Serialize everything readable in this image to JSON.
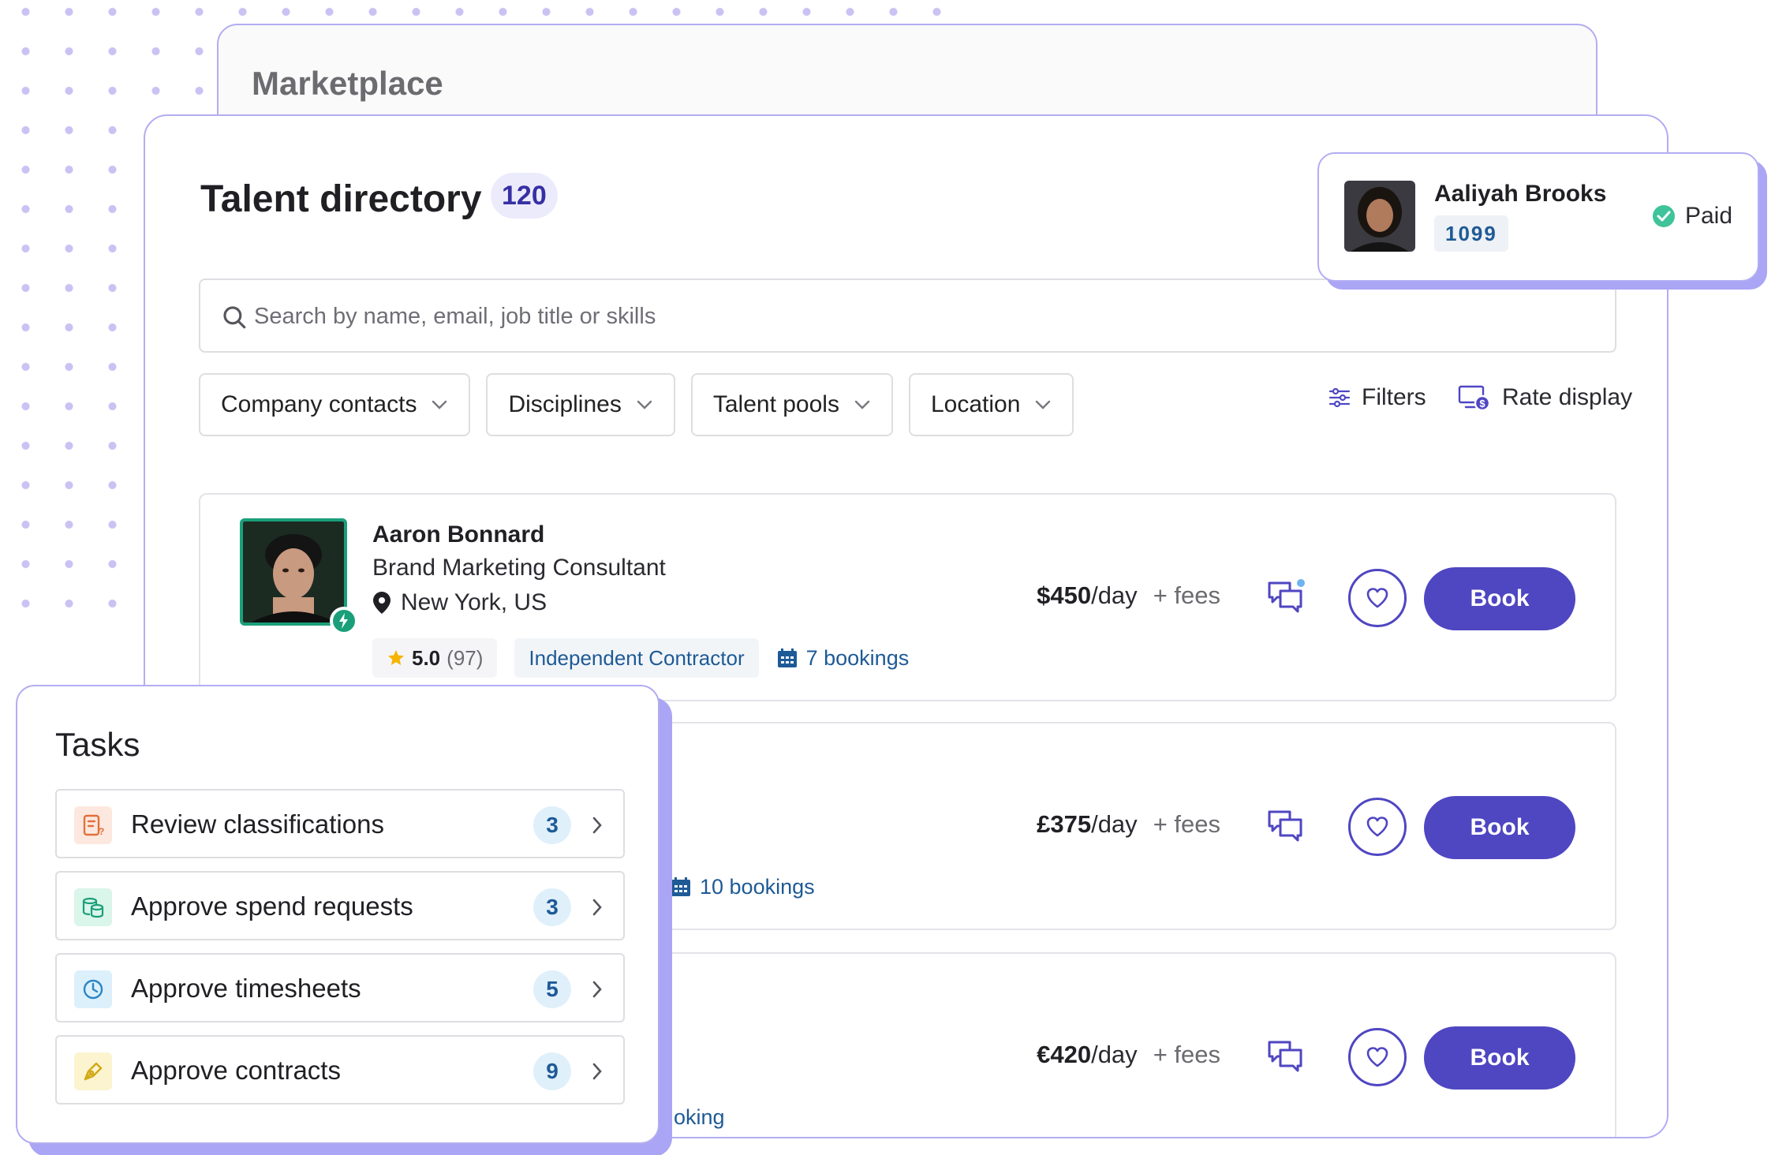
{
  "marketplace": {
    "title": "Marketplace"
  },
  "directory": {
    "title": "Talent directory",
    "count": "120",
    "search_placeholder": "Search by name, email, job title or skills",
    "filters": [
      "Company contacts",
      "Disciplines",
      "Talent pools",
      "Location"
    ],
    "tools": {
      "filters_label": "Filters",
      "rate_display_label": "Rate display"
    }
  },
  "talent": [
    {
      "name": "Aaron Bonnard",
      "job": "Brand Marketing Consultant",
      "location": "New York, US",
      "rating": "5.0",
      "reviews": "(97)",
      "type": "Independent Contractor",
      "bookings": "7 bookings",
      "rate": "$450",
      "unit": "/day",
      "fees": "+ fees",
      "book_label": "Book"
    },
    {
      "bookings": "10 bookings",
      "rate": "£375",
      "unit": "/day",
      "fees": "+ fees",
      "book_label": "Book"
    },
    {
      "bookings": "oking",
      "rate": "€420",
      "unit": "/day",
      "fees": "+ fees",
      "book_label": "Book"
    }
  ],
  "popup": {
    "name": "Aaliyah Brooks",
    "code": "1099",
    "status": "Paid",
    "status_color": "#3fc39a"
  },
  "tasks": {
    "title": "Tasks",
    "items": [
      {
        "label": "Review classifications",
        "count": "3",
        "icon": "form-icon",
        "bg": "#fde8df",
        "color": "#e2703a"
      },
      {
        "label": "Approve spend requests",
        "count": "3",
        "icon": "coins-icon",
        "bg": "#daf5ea",
        "color": "#1a9f7a"
      },
      {
        "label": "Approve timesheets",
        "count": "5",
        "icon": "clock-icon",
        "bg": "#dcf0fb",
        "color": "#2a86c7"
      },
      {
        "label": "Approve contracts",
        "count": "9",
        "icon": "pen-icon",
        "bg": "#fcf4cf",
        "color": "#d2a814"
      }
    ]
  },
  "colors": {
    "accent": "#4f46c2",
    "border_accent": "#b3adf2",
    "link": "#1e5a96",
    "verified": "#1a9f7a"
  }
}
